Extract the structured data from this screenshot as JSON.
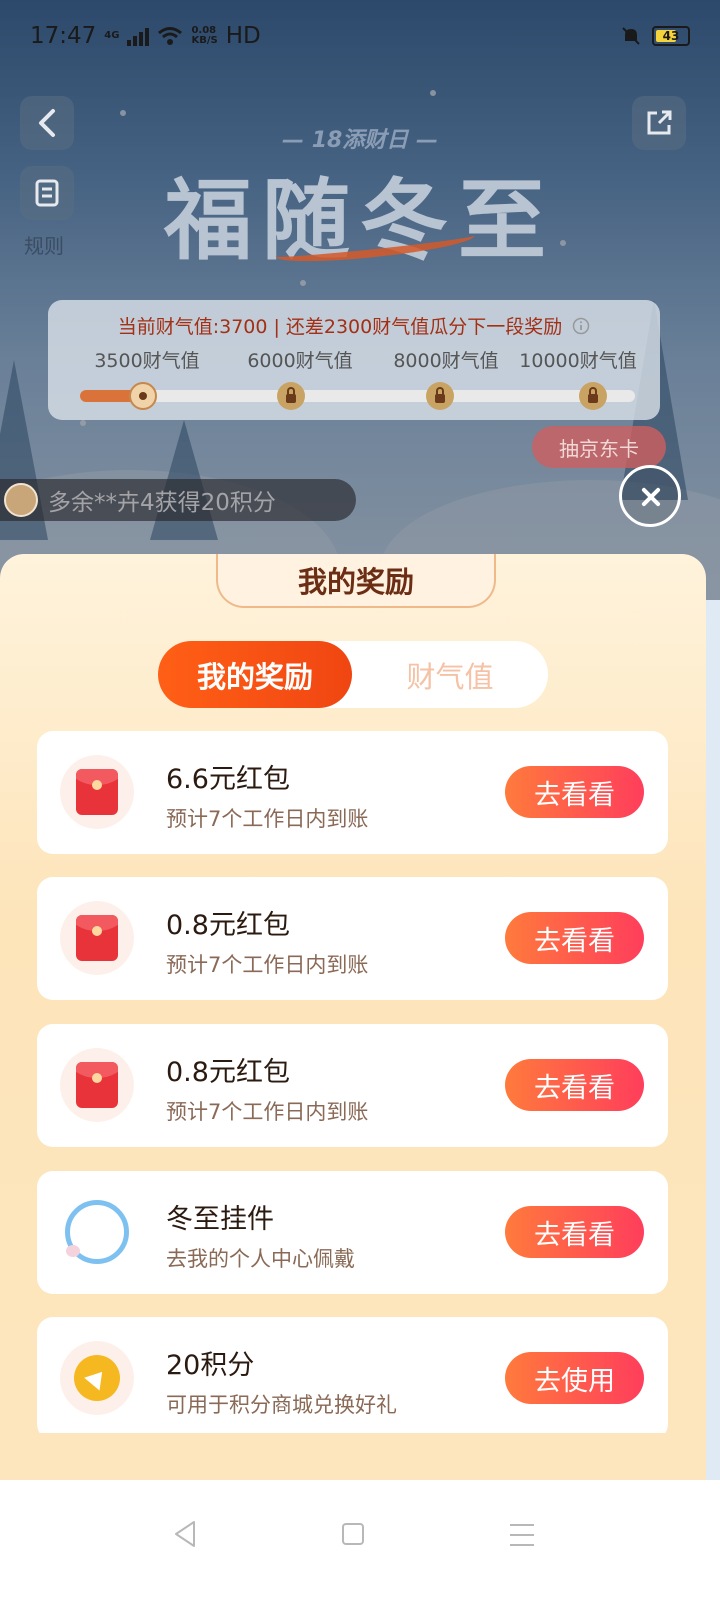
{
  "status_bar": {
    "time": "17:47",
    "net_type": "4G",
    "speed_value": "0.08",
    "speed_unit": "KB/S",
    "hd": "HD",
    "battery": "43"
  },
  "header": {
    "rules_label": "规则",
    "event_subtitle": "— 18添财日 —",
    "event_title": "福随冬至"
  },
  "progress": {
    "current_text": "当前财气值:3700",
    "remaining_text": "还差2300财气值瓜分下一段奖励",
    "current_value": 3700,
    "milestones": [
      {
        "label": "3500财气值",
        "value": 3500,
        "unlocked": true
      },
      {
        "label": "6000财气值",
        "value": 6000,
        "unlocked": false
      },
      {
        "label": "8000财气值",
        "value": 8000,
        "unlocked": false
      },
      {
        "label": "10000财气值",
        "value": 10000,
        "unlocked": false
      }
    ]
  },
  "draw_button": "抽京东卡",
  "ticker_text": "多余**卉4获得20积分",
  "sheet": {
    "title": "我的奖励",
    "tabs": [
      "我的奖励",
      "财气值"
    ],
    "active_tab": 0,
    "rewards": [
      {
        "icon": "red-envelope-icon",
        "title": "6.6元红包",
        "subtitle": "预计7个工作日内到账",
        "action": "去看看"
      },
      {
        "icon": "red-envelope-icon",
        "title": "0.8元红包",
        "subtitle": "预计7个工作日内到账",
        "action": "去看看"
      },
      {
        "icon": "red-envelope-icon",
        "title": "0.8元红包",
        "subtitle": "预计7个工作日内到账",
        "action": "去看看"
      },
      {
        "icon": "avatar-frame-icon",
        "title": "冬至挂件",
        "subtitle": "去我的个人中心佩戴",
        "action": "去看看"
      },
      {
        "icon": "points-coin-icon",
        "title": "20积分",
        "subtitle": "可用于积分商城兑换好礼",
        "action": "去使用"
      }
    ]
  },
  "colors": {
    "accent_orange": "#ff5f16",
    "button_gradient_start": "#ff7a3c",
    "button_gradient_end": "#ff3e5c",
    "sheet_bg": "#fde4b9"
  }
}
